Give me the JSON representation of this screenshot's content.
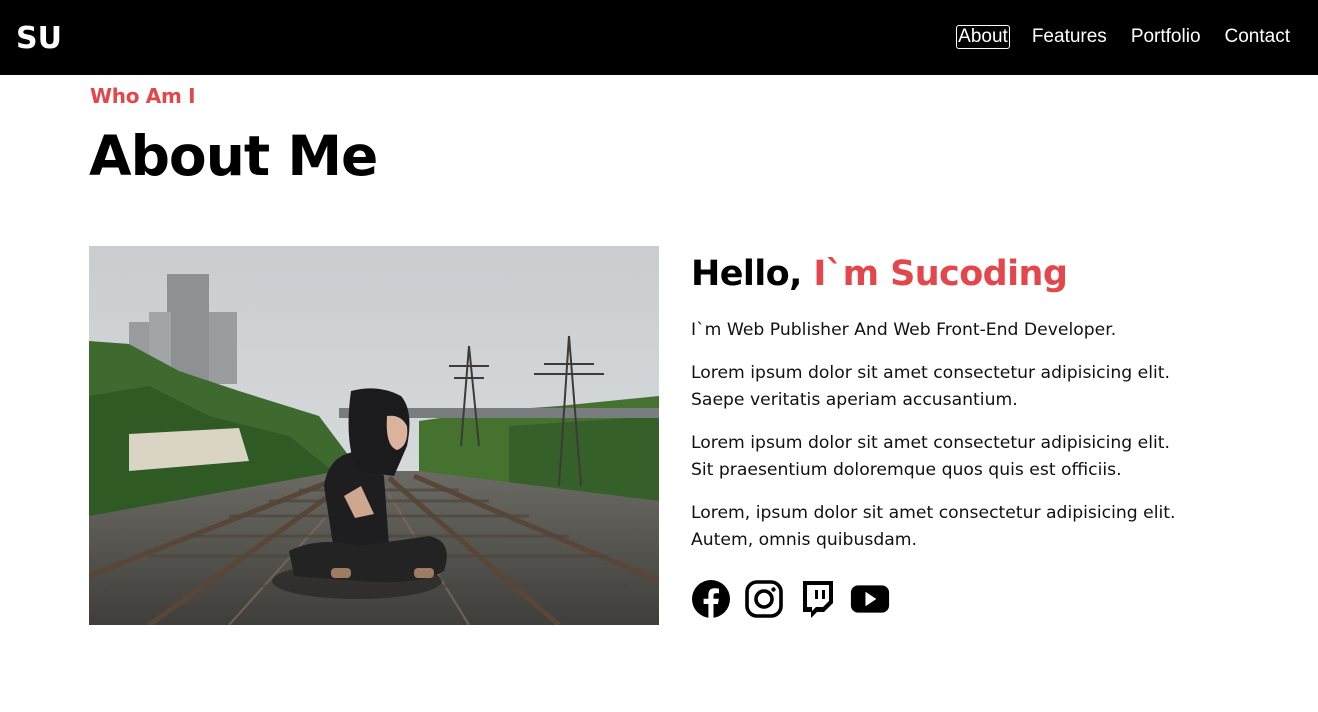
{
  "header": {
    "logo": "SU",
    "nav": [
      {
        "label": "About",
        "active": true
      },
      {
        "label": "Features"
      },
      {
        "label": "Portfolio"
      },
      {
        "label": "Contact"
      }
    ]
  },
  "section": {
    "kicker": "Who Am I",
    "title": "About Me"
  },
  "about": {
    "hello_prefix": "Hello, ",
    "hello_name": "I`m Sucoding",
    "paragraphs": [
      "I`m Web Publisher And Web Front-End Developer.",
      "Lorem ipsum dolor sit amet consectetur adipisicing elit. Saepe veritatis aperiam accusantium.",
      "Lorem ipsum dolor sit amet consectetur adipisicing elit. Sit praesentium doloremque quos quis est officiis.",
      "Lorem, ipsum dolor sit amet consectetur adipisicing elit. Autem, omnis quibusdam."
    ]
  },
  "socials": [
    "facebook-icon",
    "instagram-icon",
    "twitch-icon",
    "youtube-icon"
  ],
  "colors": {
    "accent": "#e3474b",
    "header_bg": "#000000"
  }
}
